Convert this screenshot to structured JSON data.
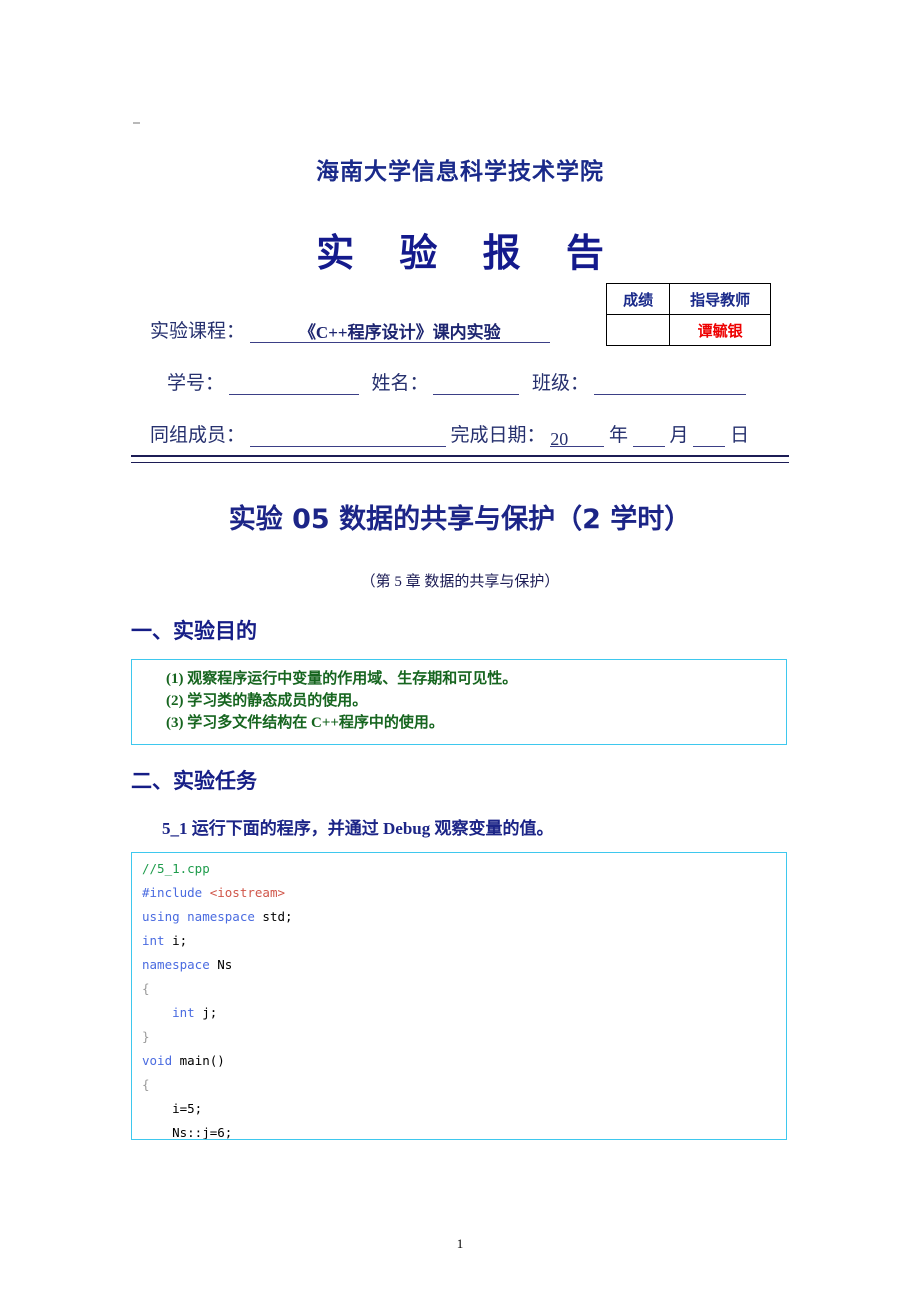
{
  "header": {
    "school_name": "海南大学信息科学技术学院",
    "report_title": "实 验 报 告"
  },
  "grade_table": {
    "header_grade": "成绩",
    "header_instructor": "指导教师",
    "grade_value": "",
    "instructor_value": "谭毓银",
    "instructor_color": "#ee0000",
    "header_color": "#1a2a8a"
  },
  "form": {
    "course_label": "实验课程：",
    "course_value": "《C++程序设计》课内实验",
    "student_id_label": "学号：",
    "student_id_value": "",
    "name_label": "姓名：",
    "name_value": "",
    "class_label": "班级：",
    "class_value": "",
    "group_members_label": "同组成员：",
    "group_members_value": "",
    "date_label": "完成日期：",
    "date_year_prefix": "20",
    "date_year_unit": "年",
    "date_month_unit": "月",
    "date_day_unit": "日"
  },
  "experiment": {
    "title": "实验 05 数据的共享与保护（2 学时）",
    "subtitle": "（第 5 章 数据的共享与保护）",
    "title_color": "#1c2587"
  },
  "sections": {
    "purpose_heading": "一、实验目的",
    "tasks_heading": "二、实验任务"
  },
  "objectives": {
    "border_color": "#3ec8ee",
    "text_color": "#16651f",
    "items": [
      "(1) 观察程序运行中变量的作用域、生存期和可见性。",
      "(2) 学习类的静态成员的使用。",
      "(3) 学习多文件结构在 C++程序中的使用。"
    ]
  },
  "task": {
    "number": "5_1",
    "description": "5_1 运行下面的程序，并通过 Debug 观察变量的值。"
  },
  "code_block": {
    "border_color": "#3ec8ee",
    "comment_color": "#1f9c4c",
    "keyword_color": "#4a6be0",
    "header_color": "#d0564a",
    "lines": [
      "//5_1.cpp",
      "#include <iostream>",
      "using namespace std;",
      "int i;",
      "namespace Ns",
      "{",
      "    int j;",
      "}",
      "void main()",
      "{",
      "    i=5;",
      "    Ns::j=6;",
      "    {"
    ]
  },
  "footer": {
    "page_number": "1"
  }
}
